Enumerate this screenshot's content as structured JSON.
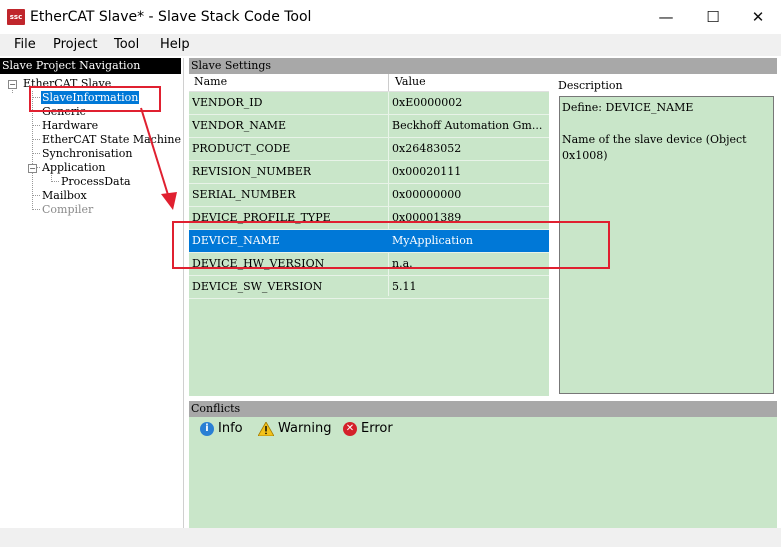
{
  "window": {
    "app_icon_text": "ssc",
    "title": "EtherCAT Slave* - Slave Stack Code Tool",
    "minimize_glyph": "—",
    "maximize_glyph": "☐",
    "close_glyph": "✕"
  },
  "menu": [
    "File",
    "Project",
    "Tool",
    "Help"
  ],
  "navigation": {
    "header": "Slave Project Navigation",
    "root": "EtherCAT Slave",
    "items": [
      "SlaveInformation",
      "Generic",
      "Hardware",
      "EtherCAT State Machine",
      "Synchronisation",
      "Application",
      "ProcessData",
      "Mailbox",
      "Compiler"
    ],
    "selected": "SlaveInformation"
  },
  "settings": {
    "header": "Slave Settings",
    "columns": [
      "Name",
      "Value"
    ],
    "rows": [
      {
        "name": "VENDOR_ID",
        "value": "0xE0000002"
      },
      {
        "name": "VENDOR_NAME",
        "value": "Beckhoff Automation Gm..."
      },
      {
        "name": "PRODUCT_CODE",
        "value": "0x26483052"
      },
      {
        "name": "REVISION_NUMBER",
        "value": "0x00020111"
      },
      {
        "name": "SERIAL_NUMBER",
        "value": "0x00000000"
      },
      {
        "name": "DEVICE_PROFILE_TYPE",
        "value": "0x00001389"
      },
      {
        "name": "DEVICE_NAME",
        "value": "MyApplication"
      },
      {
        "name": "DEVICE_HW_VERSION",
        "value": "n.a."
      },
      {
        "name": "DEVICE_SW_VERSION",
        "value": "5.11"
      }
    ],
    "selected_row": "DEVICE_NAME"
  },
  "description": {
    "header": "Description",
    "define_line": "Define: DEVICE_NAME",
    "text_line1": "Name of the slave device (Object",
    "text_line2": "0x1008)"
  },
  "conflicts": {
    "header": "Conflicts",
    "info_label": "Info",
    "warning_label": "Warning",
    "error_label": "Error"
  },
  "colors": {
    "grid_bg": "#c9e6c9",
    "selection": "#0078d7",
    "panel_header_bg": "#a8a8a8",
    "annotation_red": "#e02030"
  }
}
